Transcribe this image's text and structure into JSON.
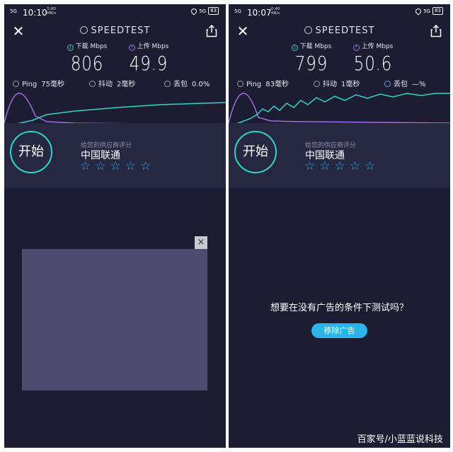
{
  "left": {
    "status": {
      "signal": "5G",
      "time": "10:10",
      "net_speed": "5.80",
      "net_unit": "MB/s",
      "net_type": "5G",
      "battery": "83"
    },
    "brand": "SPEEDTEST",
    "download": {
      "label": "下载 Mbps",
      "value": "806"
    },
    "upload": {
      "label": "上传 Mbps",
      "value": "49.9"
    },
    "ping": {
      "label": "Ping",
      "value": "75毫秒"
    },
    "jitter": {
      "label": "抖动",
      "value": "2毫秒"
    },
    "loss": {
      "label": "丢包",
      "value": "0.0%"
    },
    "start_label": "开始",
    "rate_label": "给您的供应商评分",
    "isp": "中国联通",
    "stars": [
      "☆",
      "☆",
      "☆",
      "☆",
      "☆"
    ],
    "ad_close": "×"
  },
  "right": {
    "status": {
      "signal": "5G",
      "time": "10:07",
      "net_speed": "0.40",
      "net_unit": "KB/s",
      "net_type": "5G",
      "battery": "83"
    },
    "brand": "SPEEDTEST",
    "download": {
      "label": "下载 Mbps",
      "value": "799"
    },
    "upload": {
      "label": "上传 Mbps",
      "value": "50.6"
    },
    "ping": {
      "label": "Ping",
      "value": "83毫秒"
    },
    "jitter": {
      "label": "抖动",
      "value": "1毫秒"
    },
    "loss": {
      "label": "丢包",
      "value": "—%"
    },
    "start_label": "开始",
    "rate_label": "给您的供应商评分",
    "isp": "中国联通",
    "stars": [
      "☆",
      "☆",
      "☆",
      "☆",
      "☆"
    ],
    "ad_message": "想要在没有广告的条件下测试吗？",
    "ad_remove_label": "移除广告"
  },
  "watermark": "百家号/小蓝蓝说科技",
  "colors": {
    "download": "#2fd5c9",
    "upload": "#a56de2",
    "background": "#1c1d32",
    "accent": "#35a8ea"
  },
  "icons": {
    "close": "close-icon",
    "share": "share-icon",
    "speedtest": "gauge-icon"
  }
}
